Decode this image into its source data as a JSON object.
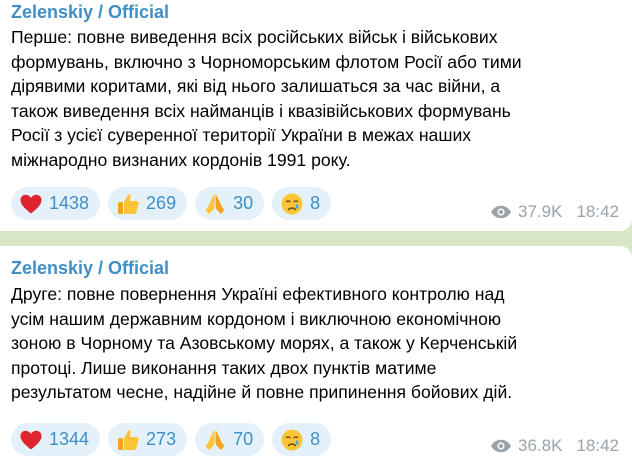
{
  "messages": [
    {
      "author": "Zelenskiy / Official",
      "text_lines": [
        "Перше: повне виведення всіх російських військ і військових",
        "формувань, включно з Чорноморським флотом Росії або тими",
        "дірявими коритами, які від нього залишаться за час війни, а",
        "також виведення всіх найманців і квазівійськових формувань",
        "Росії з усієї суверенної території України в межах наших",
        "міжнародно визнаних кордонів 1991 року."
      ],
      "reactions": [
        {
          "icon": "heart-icon",
          "count": "1438"
        },
        {
          "icon": "thumbs-up-icon",
          "count": "269"
        },
        {
          "icon": "praying-hands-icon",
          "count": "30"
        },
        {
          "icon": "crying-face-icon",
          "count": "8"
        }
      ],
      "views": "37.9K",
      "time": "18:42"
    },
    {
      "author": "Zelenskiy / Official",
      "text_lines": [
        "Друге: повне повернення Україні ефективного контролю над",
        "усім нашим державним кордоном і виключною економічною",
        "зоною в Чорному та Азовському морях, а також у Керченській",
        "протоці. Лише виконання таких двох пунктів матиме",
        "результатом чесне, надійне й повне припинення бойових дій."
      ],
      "reactions": [
        {
          "icon": "heart-icon",
          "count": "1344"
        },
        {
          "icon": "thumbs-up-icon",
          "count": "273"
        },
        {
          "icon": "praying-hands-icon",
          "count": "70"
        },
        {
          "icon": "crying-face-icon",
          "count": "8"
        }
      ],
      "views": "36.8K",
      "time": "18:42"
    }
  ],
  "colors": {
    "background": "#d9e7c9",
    "bubble": "#ffffff",
    "author": "#3f8fc5",
    "reaction_pill": "#e4f1fa",
    "meta": "#9aa3ab"
  }
}
